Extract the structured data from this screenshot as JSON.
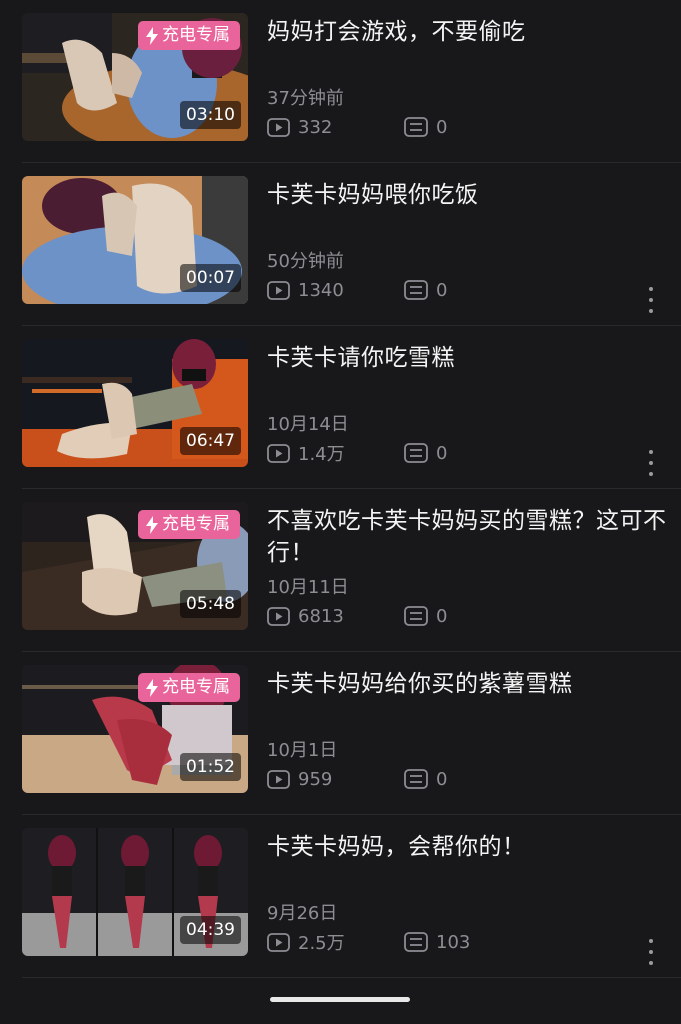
{
  "videos": [
    {
      "title": "妈妈打会游戏，不要偷吃",
      "date": "37分钟前",
      "views": "332",
      "comments": "0",
      "duration": "03:10",
      "badge": "充电专属",
      "has_more_menu": false
    },
    {
      "title": "卡芙卡妈妈喂你吃饭",
      "date": "50分钟前",
      "views": "1340",
      "comments": "0",
      "duration": "00:07",
      "badge": "",
      "has_more_menu": true
    },
    {
      "title": "卡芙卡请你吃雪糕",
      "date": "10月14日",
      "views": "1.4万",
      "comments": "0",
      "duration": "06:47",
      "badge": "",
      "has_more_menu": true
    },
    {
      "title": "不喜欢吃卡芙卡妈妈买的雪糕？这可不行！",
      "date": "10月11日",
      "views": "6813",
      "comments": "0",
      "duration": "05:48",
      "badge": "充电专属",
      "has_more_menu": false
    },
    {
      "title": "卡芙卡妈妈给你买的紫薯雪糕",
      "date": "10月1日",
      "views": "959",
      "comments": "0",
      "duration": "01:52",
      "badge": "充电专属",
      "has_more_menu": false
    },
    {
      "title": "卡芙卡妈妈，会帮你的！",
      "date": "9月26日",
      "views": "2.5万",
      "comments": "103",
      "duration": "04:39",
      "badge": "",
      "has_more_menu": true
    }
  ],
  "icons": {
    "views": "play-box-icon",
    "comments": "comment-list-icon",
    "badge": "lightning-bolt-icon",
    "more": "more-vertical-icon"
  },
  "colors": {
    "background": "#18181a",
    "badge": "#e8649a",
    "meta_text": "#8d8d93"
  }
}
